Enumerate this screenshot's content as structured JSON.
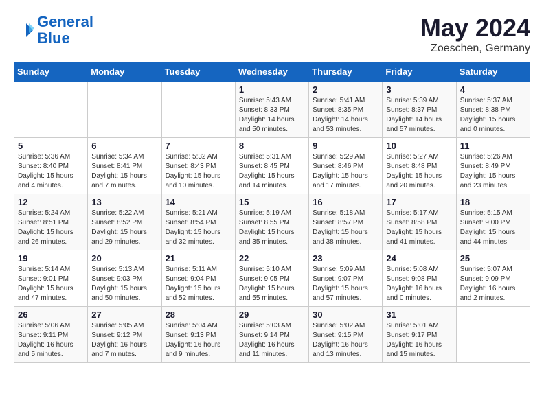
{
  "header": {
    "logo_line1": "General",
    "logo_line2": "Blue",
    "month_title": "May 2024",
    "location": "Zoeschen, Germany"
  },
  "days_of_week": [
    "Sunday",
    "Monday",
    "Tuesday",
    "Wednesday",
    "Thursday",
    "Friday",
    "Saturday"
  ],
  "weeks": [
    [
      {
        "day": "",
        "info": ""
      },
      {
        "day": "",
        "info": ""
      },
      {
        "day": "",
        "info": ""
      },
      {
        "day": "1",
        "info": "Sunrise: 5:43 AM\nSunset: 8:33 PM\nDaylight: 14 hours\nand 50 minutes."
      },
      {
        "day": "2",
        "info": "Sunrise: 5:41 AM\nSunset: 8:35 PM\nDaylight: 14 hours\nand 53 minutes."
      },
      {
        "day": "3",
        "info": "Sunrise: 5:39 AM\nSunset: 8:37 PM\nDaylight: 14 hours\nand 57 minutes."
      },
      {
        "day": "4",
        "info": "Sunrise: 5:37 AM\nSunset: 8:38 PM\nDaylight: 15 hours\nand 0 minutes."
      }
    ],
    [
      {
        "day": "5",
        "info": "Sunrise: 5:36 AM\nSunset: 8:40 PM\nDaylight: 15 hours\nand 4 minutes."
      },
      {
        "day": "6",
        "info": "Sunrise: 5:34 AM\nSunset: 8:41 PM\nDaylight: 15 hours\nand 7 minutes."
      },
      {
        "day": "7",
        "info": "Sunrise: 5:32 AM\nSunset: 8:43 PM\nDaylight: 15 hours\nand 10 minutes."
      },
      {
        "day": "8",
        "info": "Sunrise: 5:31 AM\nSunset: 8:45 PM\nDaylight: 15 hours\nand 14 minutes."
      },
      {
        "day": "9",
        "info": "Sunrise: 5:29 AM\nSunset: 8:46 PM\nDaylight: 15 hours\nand 17 minutes."
      },
      {
        "day": "10",
        "info": "Sunrise: 5:27 AM\nSunset: 8:48 PM\nDaylight: 15 hours\nand 20 minutes."
      },
      {
        "day": "11",
        "info": "Sunrise: 5:26 AM\nSunset: 8:49 PM\nDaylight: 15 hours\nand 23 minutes."
      }
    ],
    [
      {
        "day": "12",
        "info": "Sunrise: 5:24 AM\nSunset: 8:51 PM\nDaylight: 15 hours\nand 26 minutes."
      },
      {
        "day": "13",
        "info": "Sunrise: 5:22 AM\nSunset: 8:52 PM\nDaylight: 15 hours\nand 29 minutes."
      },
      {
        "day": "14",
        "info": "Sunrise: 5:21 AM\nSunset: 8:54 PM\nDaylight: 15 hours\nand 32 minutes."
      },
      {
        "day": "15",
        "info": "Sunrise: 5:19 AM\nSunset: 8:55 PM\nDaylight: 15 hours\nand 35 minutes."
      },
      {
        "day": "16",
        "info": "Sunrise: 5:18 AM\nSunset: 8:57 PM\nDaylight: 15 hours\nand 38 minutes."
      },
      {
        "day": "17",
        "info": "Sunrise: 5:17 AM\nSunset: 8:58 PM\nDaylight: 15 hours\nand 41 minutes."
      },
      {
        "day": "18",
        "info": "Sunrise: 5:15 AM\nSunset: 9:00 PM\nDaylight: 15 hours\nand 44 minutes."
      }
    ],
    [
      {
        "day": "19",
        "info": "Sunrise: 5:14 AM\nSunset: 9:01 PM\nDaylight: 15 hours\nand 47 minutes."
      },
      {
        "day": "20",
        "info": "Sunrise: 5:13 AM\nSunset: 9:03 PM\nDaylight: 15 hours\nand 50 minutes."
      },
      {
        "day": "21",
        "info": "Sunrise: 5:11 AM\nSunset: 9:04 PM\nDaylight: 15 hours\nand 52 minutes."
      },
      {
        "day": "22",
        "info": "Sunrise: 5:10 AM\nSunset: 9:05 PM\nDaylight: 15 hours\nand 55 minutes."
      },
      {
        "day": "23",
        "info": "Sunrise: 5:09 AM\nSunset: 9:07 PM\nDaylight: 15 hours\nand 57 minutes."
      },
      {
        "day": "24",
        "info": "Sunrise: 5:08 AM\nSunset: 9:08 PM\nDaylight: 16 hours\nand 0 minutes."
      },
      {
        "day": "25",
        "info": "Sunrise: 5:07 AM\nSunset: 9:09 PM\nDaylight: 16 hours\nand 2 minutes."
      }
    ],
    [
      {
        "day": "26",
        "info": "Sunrise: 5:06 AM\nSunset: 9:11 PM\nDaylight: 16 hours\nand 5 minutes."
      },
      {
        "day": "27",
        "info": "Sunrise: 5:05 AM\nSunset: 9:12 PM\nDaylight: 16 hours\nand 7 minutes."
      },
      {
        "day": "28",
        "info": "Sunrise: 5:04 AM\nSunset: 9:13 PM\nDaylight: 16 hours\nand 9 minutes."
      },
      {
        "day": "29",
        "info": "Sunrise: 5:03 AM\nSunset: 9:14 PM\nDaylight: 16 hours\nand 11 minutes."
      },
      {
        "day": "30",
        "info": "Sunrise: 5:02 AM\nSunset: 9:15 PM\nDaylight: 16 hours\nand 13 minutes."
      },
      {
        "day": "31",
        "info": "Sunrise: 5:01 AM\nSunset: 9:17 PM\nDaylight: 16 hours\nand 15 minutes."
      },
      {
        "day": "",
        "info": ""
      }
    ]
  ]
}
